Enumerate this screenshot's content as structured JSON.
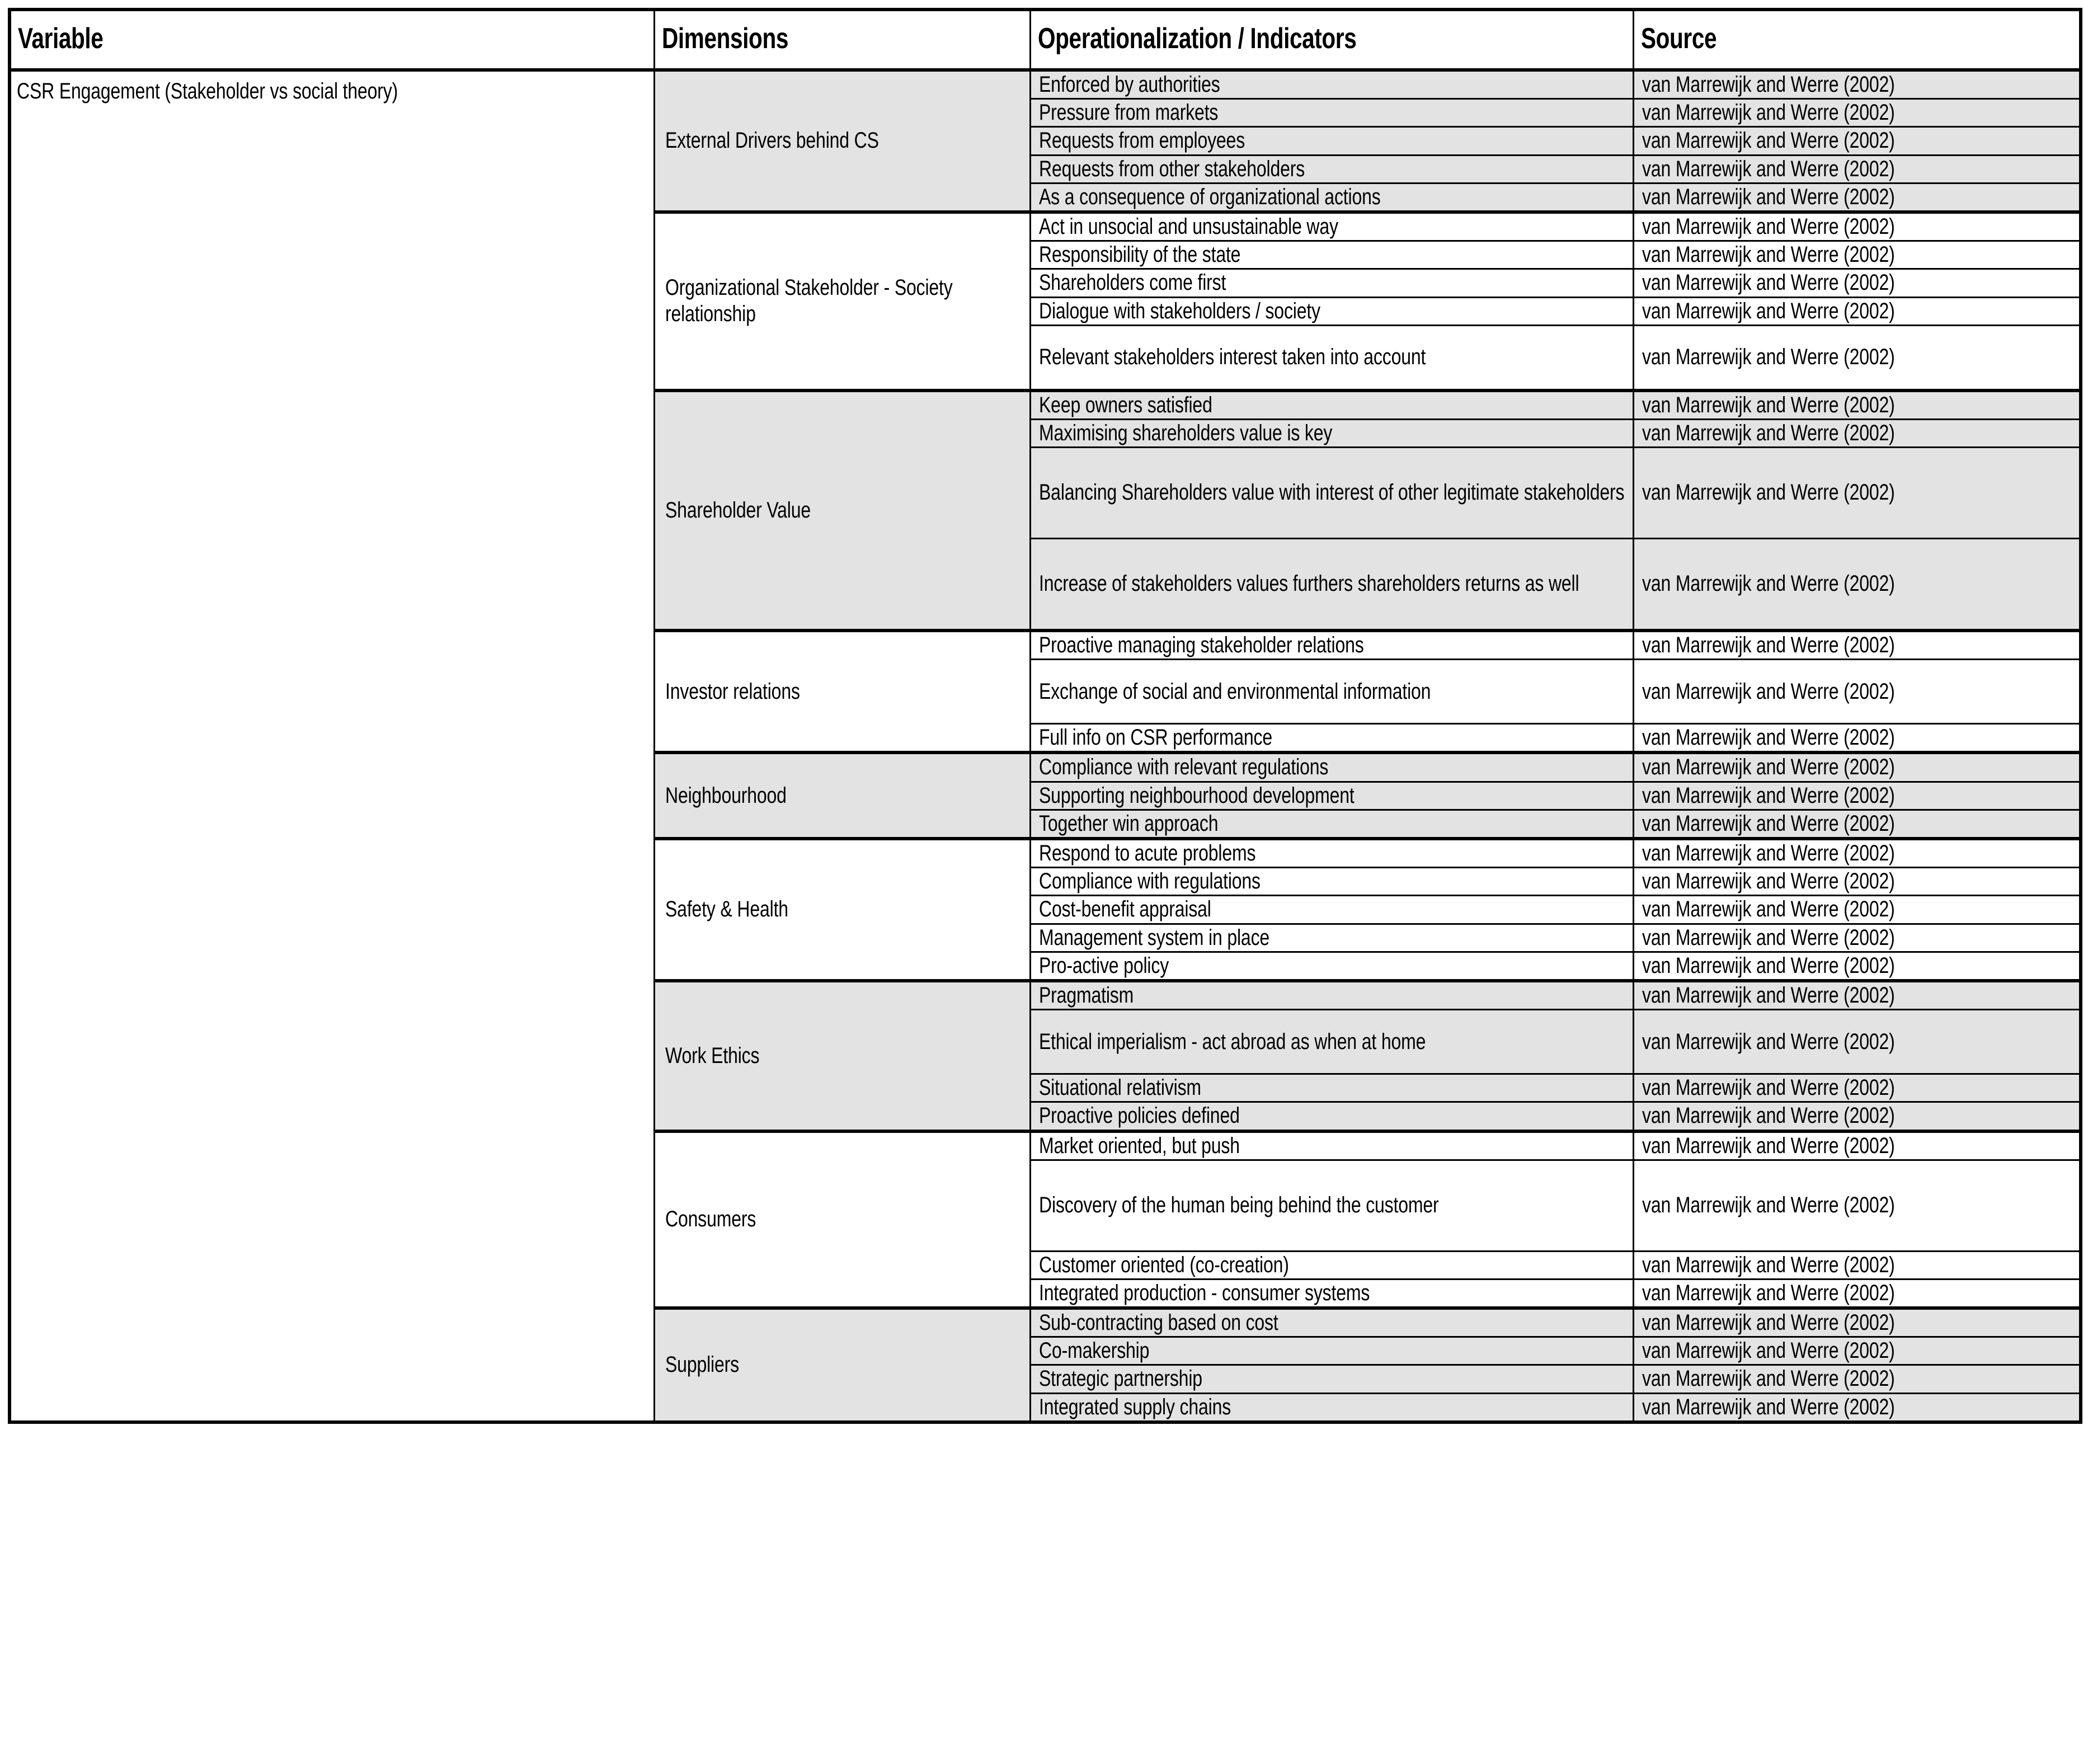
{
  "table": {
    "headers": [
      "Variable",
      "Dimensions",
      "Operationalization / Indicators",
      "Source"
    ],
    "variable": "CSR Engagement (Stakeholder vs social theory)",
    "source_label": "van Marrewijk and Werre (2002)",
    "colors": {
      "shade": "#e3e3e3",
      "plain": "#ffffff",
      "border": "#000000",
      "text": "#000000"
    },
    "groups": [
      {
        "dimension": "External Drivers behind CS",
        "shaded": true,
        "rows": [
          {
            "indicator": "Enforced by authorities",
            "source": "van Marrewijk and Werre (2002)"
          },
          {
            "indicator": "Pressure from markets",
            "source": "van Marrewijk and Werre (2002)"
          },
          {
            "indicator": "Requests from employees",
            "source": "van Marrewijk and Werre (2002)"
          },
          {
            "indicator": "Requests from other stakeholders",
            "source": "van Marrewijk and Werre (2002)"
          },
          {
            "indicator": "As a consequence of organizational actions",
            "source": "van Marrewijk and Werre (2002)"
          }
        ]
      },
      {
        "dimension": "Organizational Stakeholder - Society relationship",
        "shaded": false,
        "rows": [
          {
            "indicator": "Act in unsocial and unsustainable way",
            "source": "van Marrewijk and Werre (2002)"
          },
          {
            "indicator": "Responsibility of the state",
            "source": "van Marrewijk and Werre (2002)"
          },
          {
            "indicator": "Shareholders come first",
            "source": "van Marrewijk and Werre (2002)"
          },
          {
            "indicator": "Dialogue with stakeholders / society",
            "source": "van Marrewijk and Werre (2002)"
          },
          {
            "indicator": "Relevant stakeholders interest taken into account",
            "source": "van Marrewijk and Werre (2002)",
            "tall": true
          }
        ]
      },
      {
        "dimension": "Shareholder Value",
        "shaded": true,
        "rows": [
          {
            "indicator": "Keep owners satisfied",
            "source": "van Marrewijk and Werre (2002)"
          },
          {
            "indicator": "Maximising shareholders value is key",
            "source": "van Marrewijk and Werre (2002)"
          },
          {
            "indicator": "Balancing Shareholders value with interest of other legitimate stakeholders",
            "source": "van Marrewijk and Werre (2002)",
            "two_line": true
          },
          {
            "indicator": "Increase of stakeholders values furthers shareholders returns as well",
            "source": "van Marrewijk and Werre (2002)",
            "two_line": true
          }
        ]
      },
      {
        "dimension": "Investor relations",
        "shaded": false,
        "rows": [
          {
            "indicator": "Proactive managing stakeholder relations",
            "source": "van Marrewijk and Werre (2002)"
          },
          {
            "indicator": "Exchange of social and environmental information",
            "source": "van Marrewijk and Werre (2002)",
            "tall": true
          },
          {
            "indicator": "Full info on CSR performance",
            "source": "van Marrewijk and Werre (2002)"
          }
        ]
      },
      {
        "dimension": "Neighbourhood",
        "shaded": true,
        "rows": [
          {
            "indicator": "Compliance with relevant regulations",
            "source": "van Marrewijk and Werre (2002)"
          },
          {
            "indicator": "Supporting neighbourhood development",
            "source": "van Marrewijk and Werre (2002)"
          },
          {
            "indicator": "Together win approach",
            "source": "van Marrewijk and Werre (2002)"
          }
        ]
      },
      {
        "dimension": "Safety & Health",
        "shaded": false,
        "rows": [
          {
            "indicator": "Respond to acute problems",
            "source": "van Marrewijk and Werre (2002)"
          },
          {
            "indicator": "Compliance with regulations",
            "source": "van Marrewijk and Werre (2002)"
          },
          {
            "indicator": "Cost-benefit appraisal",
            "source": "van Marrewijk and Werre (2002)"
          },
          {
            "indicator": "Management system in place",
            "source": "van Marrewijk and Werre (2002)"
          },
          {
            "indicator": "Pro-active policy",
            "source": "van Marrewijk and Werre (2002)"
          }
        ]
      },
      {
        "dimension": "Work Ethics",
        "shaded": true,
        "rows": [
          {
            "indicator": "Pragmatism",
            "source": "van Marrewijk and Werre (2002)"
          },
          {
            "indicator": "Ethical imperialism - act abroad as when at home",
            "source": "van Marrewijk and Werre (2002)",
            "tall": true
          },
          {
            "indicator": "Situational relativism",
            "source": "van Marrewijk and Werre (2002)"
          },
          {
            "indicator": "Proactive policies defined",
            "source": "van Marrewijk and Werre (2002)"
          }
        ]
      },
      {
        "dimension": "Consumers",
        "shaded": false,
        "rows": [
          {
            "indicator": "Market oriented, but push",
            "source": "van Marrewijk and Werre (2002)"
          },
          {
            "indicator": "Discovery of the human being behind the customer",
            "source": "van Marrewijk and Werre (2002)",
            "two_line": true
          },
          {
            "indicator": "Customer oriented (co-creation)",
            "source": "van Marrewijk and Werre (2002)"
          },
          {
            "indicator": "Integrated production - consumer systems",
            "source": "van Marrewijk and Werre (2002)"
          }
        ]
      },
      {
        "dimension": "Suppliers",
        "shaded": true,
        "rows": [
          {
            "indicator": "Sub-contracting based on cost",
            "source": "van Marrewijk and Werre (2002)"
          },
          {
            "indicator": "Co-makership",
            "source": "van Marrewijk and Werre (2002)"
          },
          {
            "indicator": "Strategic partnership",
            "source": "van Marrewijk and Werre (2002)"
          },
          {
            "indicator": "Integrated supply chains",
            "source": "van Marrewijk and Werre (2002)"
          }
        ]
      }
    ]
  }
}
